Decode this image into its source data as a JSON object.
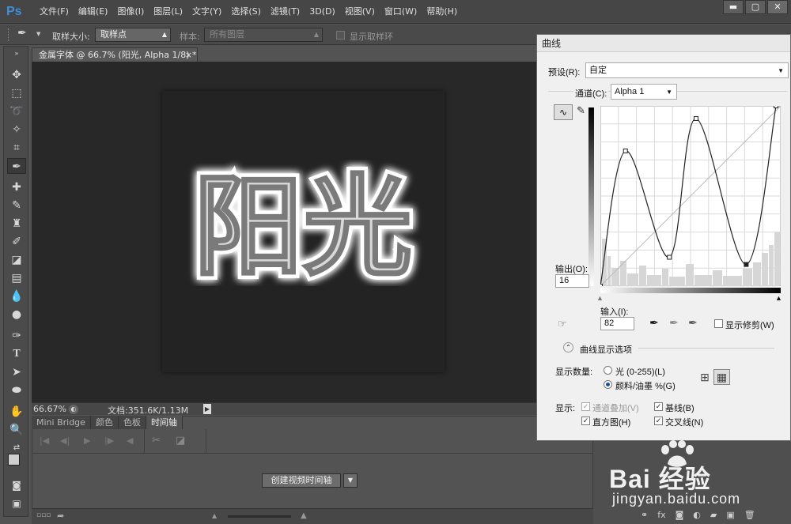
{
  "app": {
    "logo": "Ps"
  },
  "menu": [
    "文件(F)",
    "编辑(E)",
    "图像(I)",
    "图层(L)",
    "文字(Y)",
    "选择(S)",
    "滤镜(T)",
    "3D(D)",
    "视图(V)",
    "窗口(W)",
    "帮助(H)"
  ],
  "window_controls": {
    "minimize": "▬",
    "maximize": "▢",
    "close": "✕"
  },
  "options": {
    "sample_size_label": "取样大小:",
    "sample_size_value": "取样点",
    "sample_label": "样本:",
    "sample_value": "所有图层",
    "show_ring_label": "显示取样环"
  },
  "document": {
    "tab_title": "金属字体 @ 66.7% (阳光, Alpha 1/8) *",
    "tab_close": "×",
    "artwork_text": "阳光"
  },
  "status": {
    "zoom": "66.67%",
    "doc_info": "文档:351.6K/1.13M"
  },
  "panel_tabs": [
    "Mini Bridge",
    "颜色",
    "色板",
    "时间轴"
  ],
  "timeline": {
    "create_button": "创建视频时间轴"
  },
  "curves": {
    "title": "曲线",
    "preset_label": "预设(R):",
    "preset_value": "自定",
    "channel_label": "通道(C):",
    "channel_value": "Alpha 1",
    "output_label": "输出(O):",
    "output_value": "16",
    "input_label": "输入(I):",
    "input_value": "82",
    "show_clipping_label": "显示修剪(W)",
    "display_options_label": "曲线显示选项",
    "show_amount_label": "显示数量:",
    "light_option": "光 (0-255)(L)",
    "pigment_option": "颜料/油墨 %(G)",
    "show_label": "显示:",
    "channel_overlay": "通道叠加(V)",
    "baseline": "基线(B)",
    "histogram": "直方图(H)",
    "intersection": "交叉线(N)",
    "points": [
      [
        0,
        0
      ],
      [
        32,
        0.75
      ],
      [
        88,
        0.16
      ],
      [
        122,
        0.93
      ],
      [
        186,
        0.12
      ],
      [
        224,
        1
      ]
    ]
  },
  "watermark": {
    "brand": "Bai 经验",
    "url": "jingyan.baidu.com"
  }
}
